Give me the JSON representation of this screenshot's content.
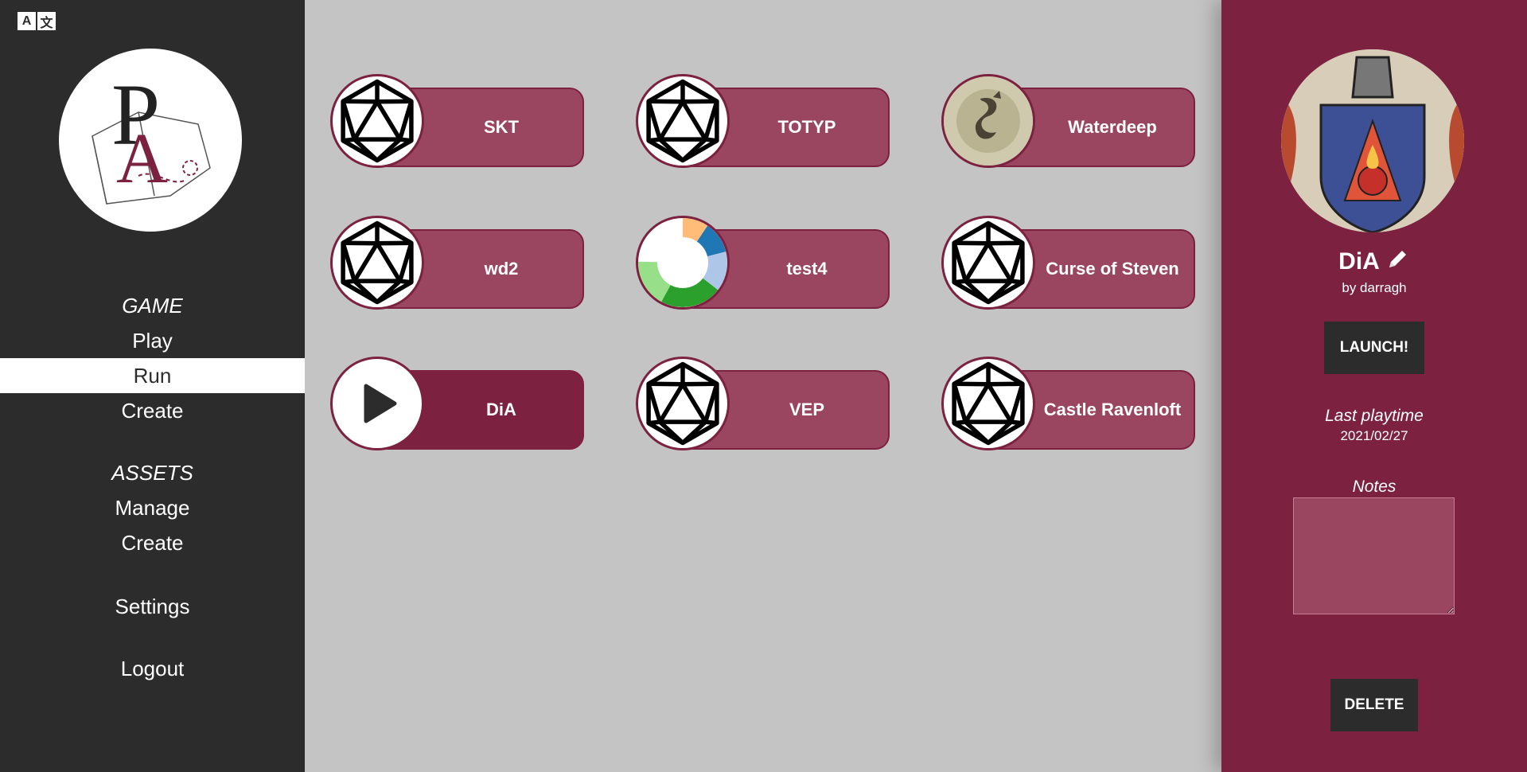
{
  "language_toggle": {
    "left": "A",
    "right": "文"
  },
  "sidebar": {
    "sections": [
      {
        "heading": "GAME",
        "items": [
          "Play",
          "Run",
          "Create"
        ]
      },
      {
        "heading": "ASSETS",
        "items": [
          "Manage",
          "Create"
        ]
      }
    ],
    "settings": "Settings",
    "logout": "Logout",
    "active_item": "Run"
  },
  "games": [
    {
      "name": "SKT",
      "icon": "d20-icon"
    },
    {
      "name": "TOTYP",
      "icon": "d20-icon"
    },
    {
      "name": "Waterdeep",
      "icon": "waterdeep-image"
    },
    {
      "name": "wd2",
      "icon": "d20-icon"
    },
    {
      "name": "test4",
      "icon": "donut-chart-icon"
    },
    {
      "name": "Curse of Steven",
      "icon": "d20-icon"
    },
    {
      "name": "DiA",
      "icon": "play-icon"
    },
    {
      "name": "VEP",
      "icon": "d20-icon"
    },
    {
      "name": "Castle Ravenloft",
      "icon": "d20-icon"
    }
  ],
  "details": {
    "title": "DiA",
    "author": "by darragh",
    "launch": "LAUNCH!",
    "last_playtime_label": "Last playtime",
    "last_playtime": "2021/02/27",
    "notes_label": "Notes",
    "notes": "",
    "delete": "DELETE"
  },
  "colors": {
    "sidebar_bg": "#2c2c2c",
    "main_bg": "#c4c4c4",
    "accent": "#7c2140",
    "card": "#9a4661"
  }
}
